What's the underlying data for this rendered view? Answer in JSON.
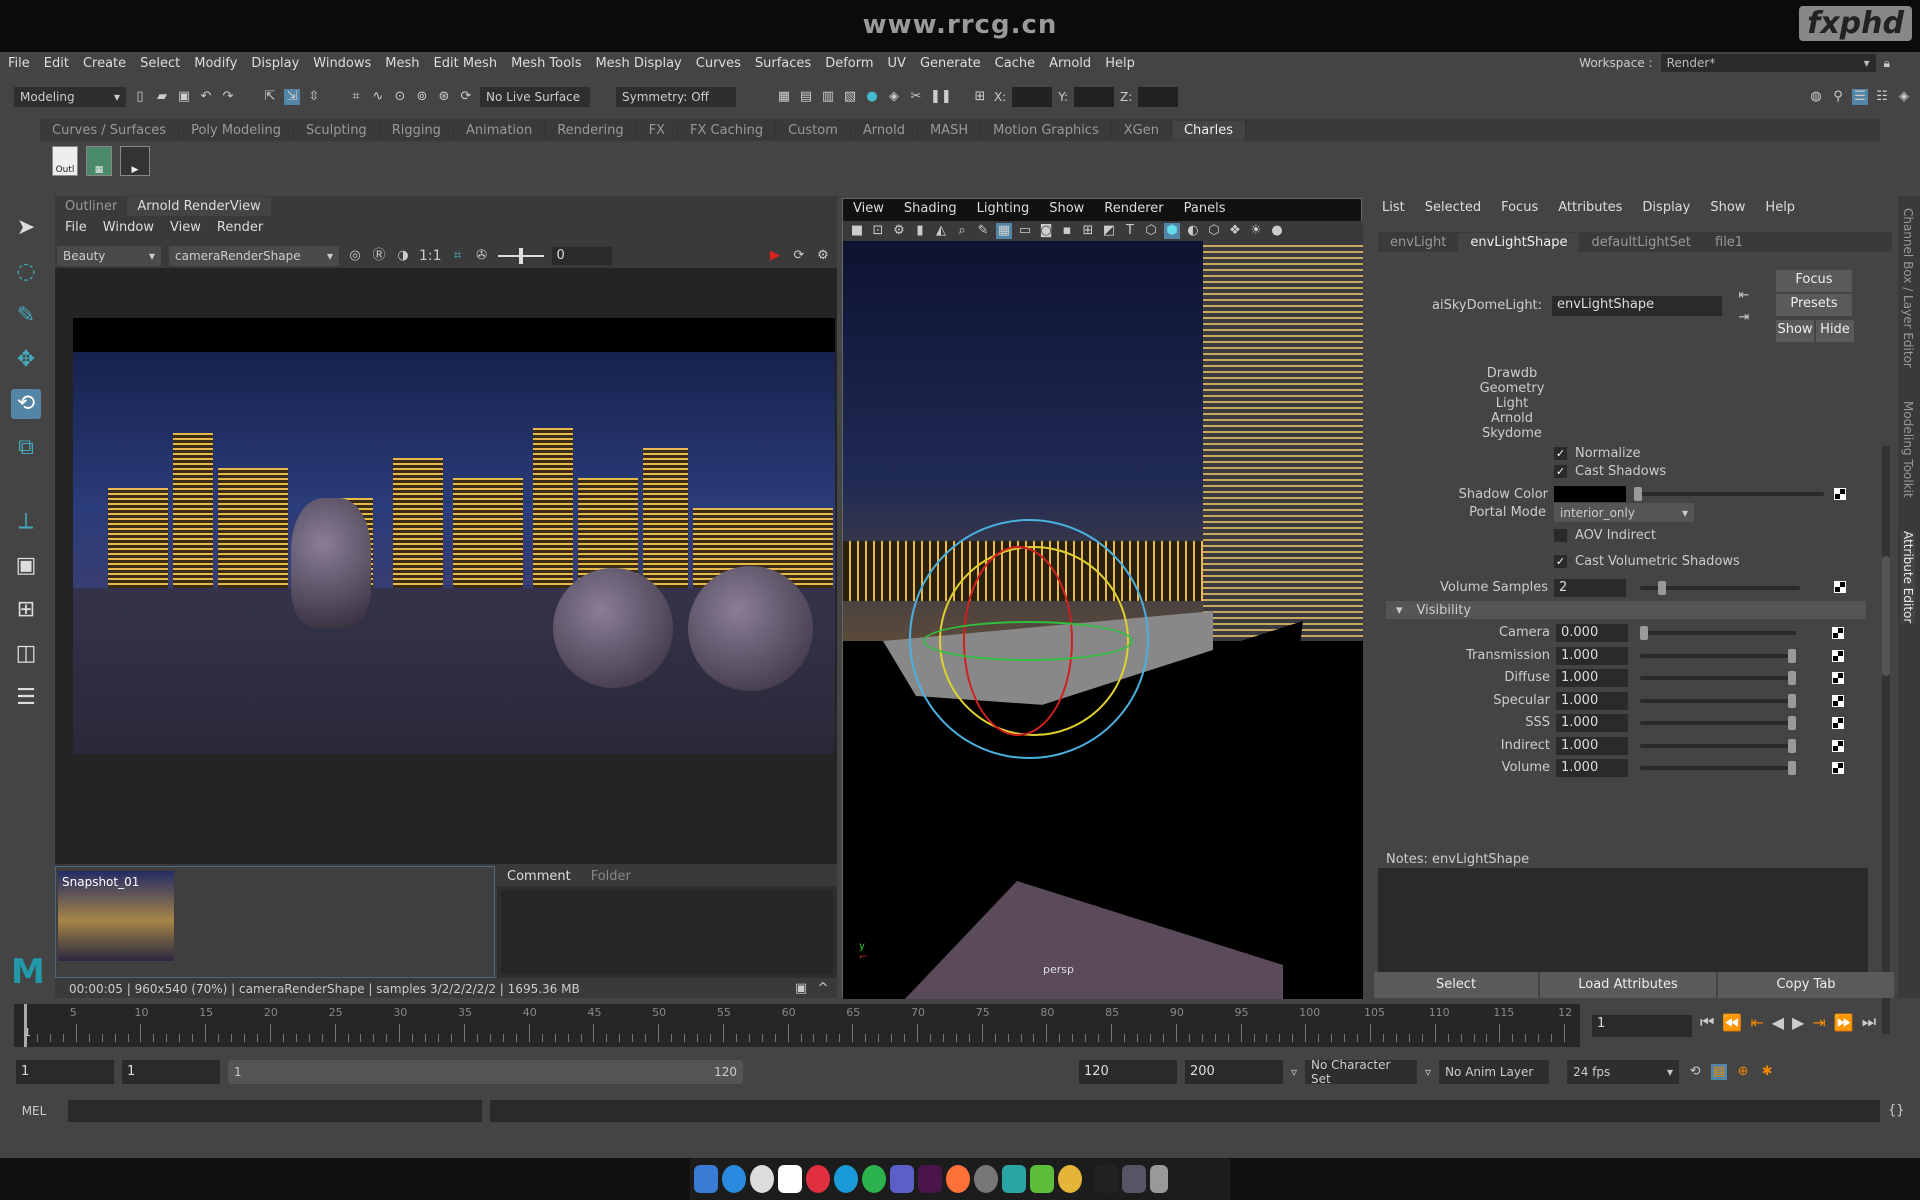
{
  "site": {
    "watermark_url": "www.rrcg.cn",
    "logo": "fxphd"
  },
  "menubar": [
    "File",
    "Edit",
    "Create",
    "Select",
    "Modify",
    "Display",
    "Windows",
    "Mesh",
    "Edit Mesh",
    "Mesh Tools",
    "Mesh Display",
    "Curves",
    "Surfaces",
    "Deform",
    "UV",
    "Generate",
    "Cache",
    "Arnold",
    "Help"
  ],
  "workspace": {
    "label": "Workspace :",
    "value": "Render*"
  },
  "toolbar": {
    "mode": "Modeling",
    "live_surface": "No Live Surface",
    "symmetry": "Symmetry: Off",
    "x": "X:",
    "y": "Y:",
    "z": "Z:"
  },
  "shelf": {
    "tabs": [
      "Curves / Surfaces",
      "Poly Modeling",
      "Sculpting",
      "Rigging",
      "Animation",
      "Rendering",
      "FX",
      "FX Caching",
      "Custom",
      "Arnold",
      "MASH",
      "Motion Graphics",
      "XGen",
      "Charles"
    ],
    "active": "Charles",
    "icons": [
      "Outl",
      "",
      ""
    ]
  },
  "renderview": {
    "tabs": [
      "Outliner",
      "Arnold RenderView"
    ],
    "menu": [
      "File",
      "Window",
      "View",
      "Render"
    ],
    "aov": "Beauty",
    "camera": "cameraRenderShape",
    "ratio": "1:1",
    "exposure": "0",
    "snapshot": "Snapshot_01",
    "comment_tabs": [
      "Comment",
      "Folder"
    ],
    "status": "00:00:05 | 960x540 (70%) | cameraRenderShape  | samples 3/2/2/2/2/2 | 1695.36 MB"
  },
  "viewport": {
    "menu": [
      "View",
      "Shading",
      "Lighting",
      "Show",
      "Renderer",
      "Panels"
    ],
    "camera_label": "persp"
  },
  "attribute_editor": {
    "menu": [
      "List",
      "Selected",
      "Focus",
      "Attributes",
      "Display",
      "Show",
      "Help"
    ],
    "tabs": [
      "envLight",
      "envLightShape",
      "defaultLightSet",
      "file1"
    ],
    "active_tab": "envLightShape",
    "node_type": "aiSkyDomeLight:",
    "node_name": "envLightShape",
    "buttons": {
      "focus": "Focus",
      "presets": "Presets",
      "show": "Show",
      "hide": "Hide"
    },
    "classification": [
      "Drawdb",
      "Geometry",
      "Light",
      "Arnold",
      "Skydome"
    ],
    "partial_label": "Normalize",
    "cast_shadows": "Cast Shadows",
    "shadow_color": "Shadow Color",
    "portal_mode": {
      "label": "Portal Mode",
      "value": "interior_only"
    },
    "aov_indirect": "AOV Indirect",
    "cast_volumetric": "Cast Volumetric Shadows",
    "volume_samples": {
      "label": "Volume Samples",
      "value": "2",
      "fraction": 0.12
    },
    "visibility": {
      "title": "Visibility",
      "rows": [
        {
          "label": "Camera",
          "value": "0.000",
          "fraction": 0
        },
        {
          "label": "Transmission",
          "value": "1.000",
          "fraction": 1
        },
        {
          "label": "Diffuse",
          "value": "1.000",
          "fraction": 1
        },
        {
          "label": "Specular",
          "value": "1.000",
          "fraction": 1
        },
        {
          "label": "SSS",
          "value": "1.000",
          "fraction": 1
        },
        {
          "label": "Indirect",
          "value": "1.000",
          "fraction": 1
        },
        {
          "label": "Volume",
          "value": "1.000",
          "fraction": 1
        }
      ]
    },
    "notes": "Notes:  envLightShape",
    "bottom": [
      "Select",
      "Load Attributes",
      "Copy Tab"
    ]
  },
  "side_tabs": [
    "Channel Box / Layer Editor",
    "Modeling Toolkit",
    "Attribute Editor"
  ],
  "timeline": {
    "ticks": [
      "5",
      "10",
      "15",
      "20",
      "25",
      "30",
      "35",
      "40",
      "45",
      "50",
      "55",
      "60",
      "65",
      "70",
      "75",
      "80",
      "85",
      "90",
      "95",
      "100",
      "105",
      "110",
      "115",
      "12"
    ],
    "start_marker": "1",
    "current_frame": "1"
  },
  "range": {
    "start": "1",
    "playback_start": "1",
    "slider_start": "1",
    "slider_end": "120",
    "playback_end": "120",
    "end": "200",
    "character_set": "No Character Set",
    "anim_layer": "No Anim Layer",
    "fps": "24 fps"
  },
  "command_line": {
    "language": "MEL"
  },
  "colors": {
    "accent": "#5285a6",
    "panel": "#444444",
    "field": "#2a2a2a"
  }
}
